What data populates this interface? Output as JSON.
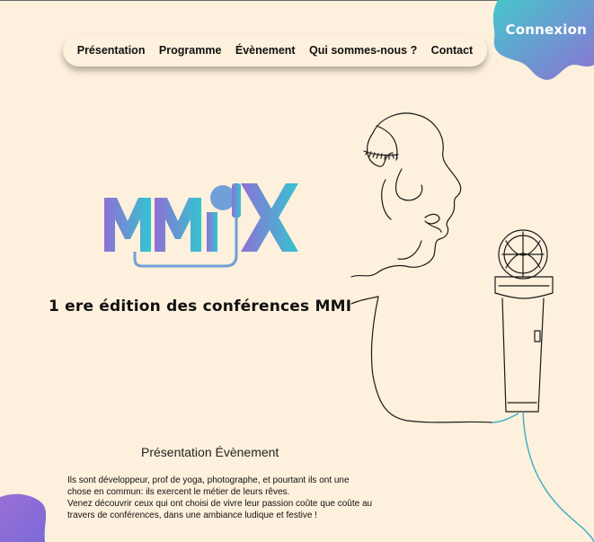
{
  "header": {
    "login_label": "Connexion",
    "nav": [
      {
        "label": "Présentation"
      },
      {
        "label": "Programme"
      },
      {
        "label": "Évènement"
      },
      {
        "label": "Qui sommes-nous ?"
      },
      {
        "label": "Contact"
      }
    ]
  },
  "hero": {
    "logo_text": "MMIX",
    "title": "1 ere édition des conférences MMI"
  },
  "presentation": {
    "heading": "Présentation Évènement",
    "paragraph_1": "Ils sont  développeur, prof de yoga, photographe, et pourtant ils ont une chose en commun: ils exercent le métier de leurs rêves.",
    "paragraph_2": "Venez découvrir ceux qui ont choisi de vivre leur passion coûte que coûte au travers de conférences, dans une ambiance ludique et festive !"
  },
  "colors": {
    "background": "#fdf0dc",
    "gradient_start": "#9b6fd6",
    "gradient_end": "#35c3cf",
    "cable": "#3aaec0"
  },
  "icons": {
    "logo": "mmix-microphone-logo",
    "illustration": "singer-line-art-illustration"
  }
}
